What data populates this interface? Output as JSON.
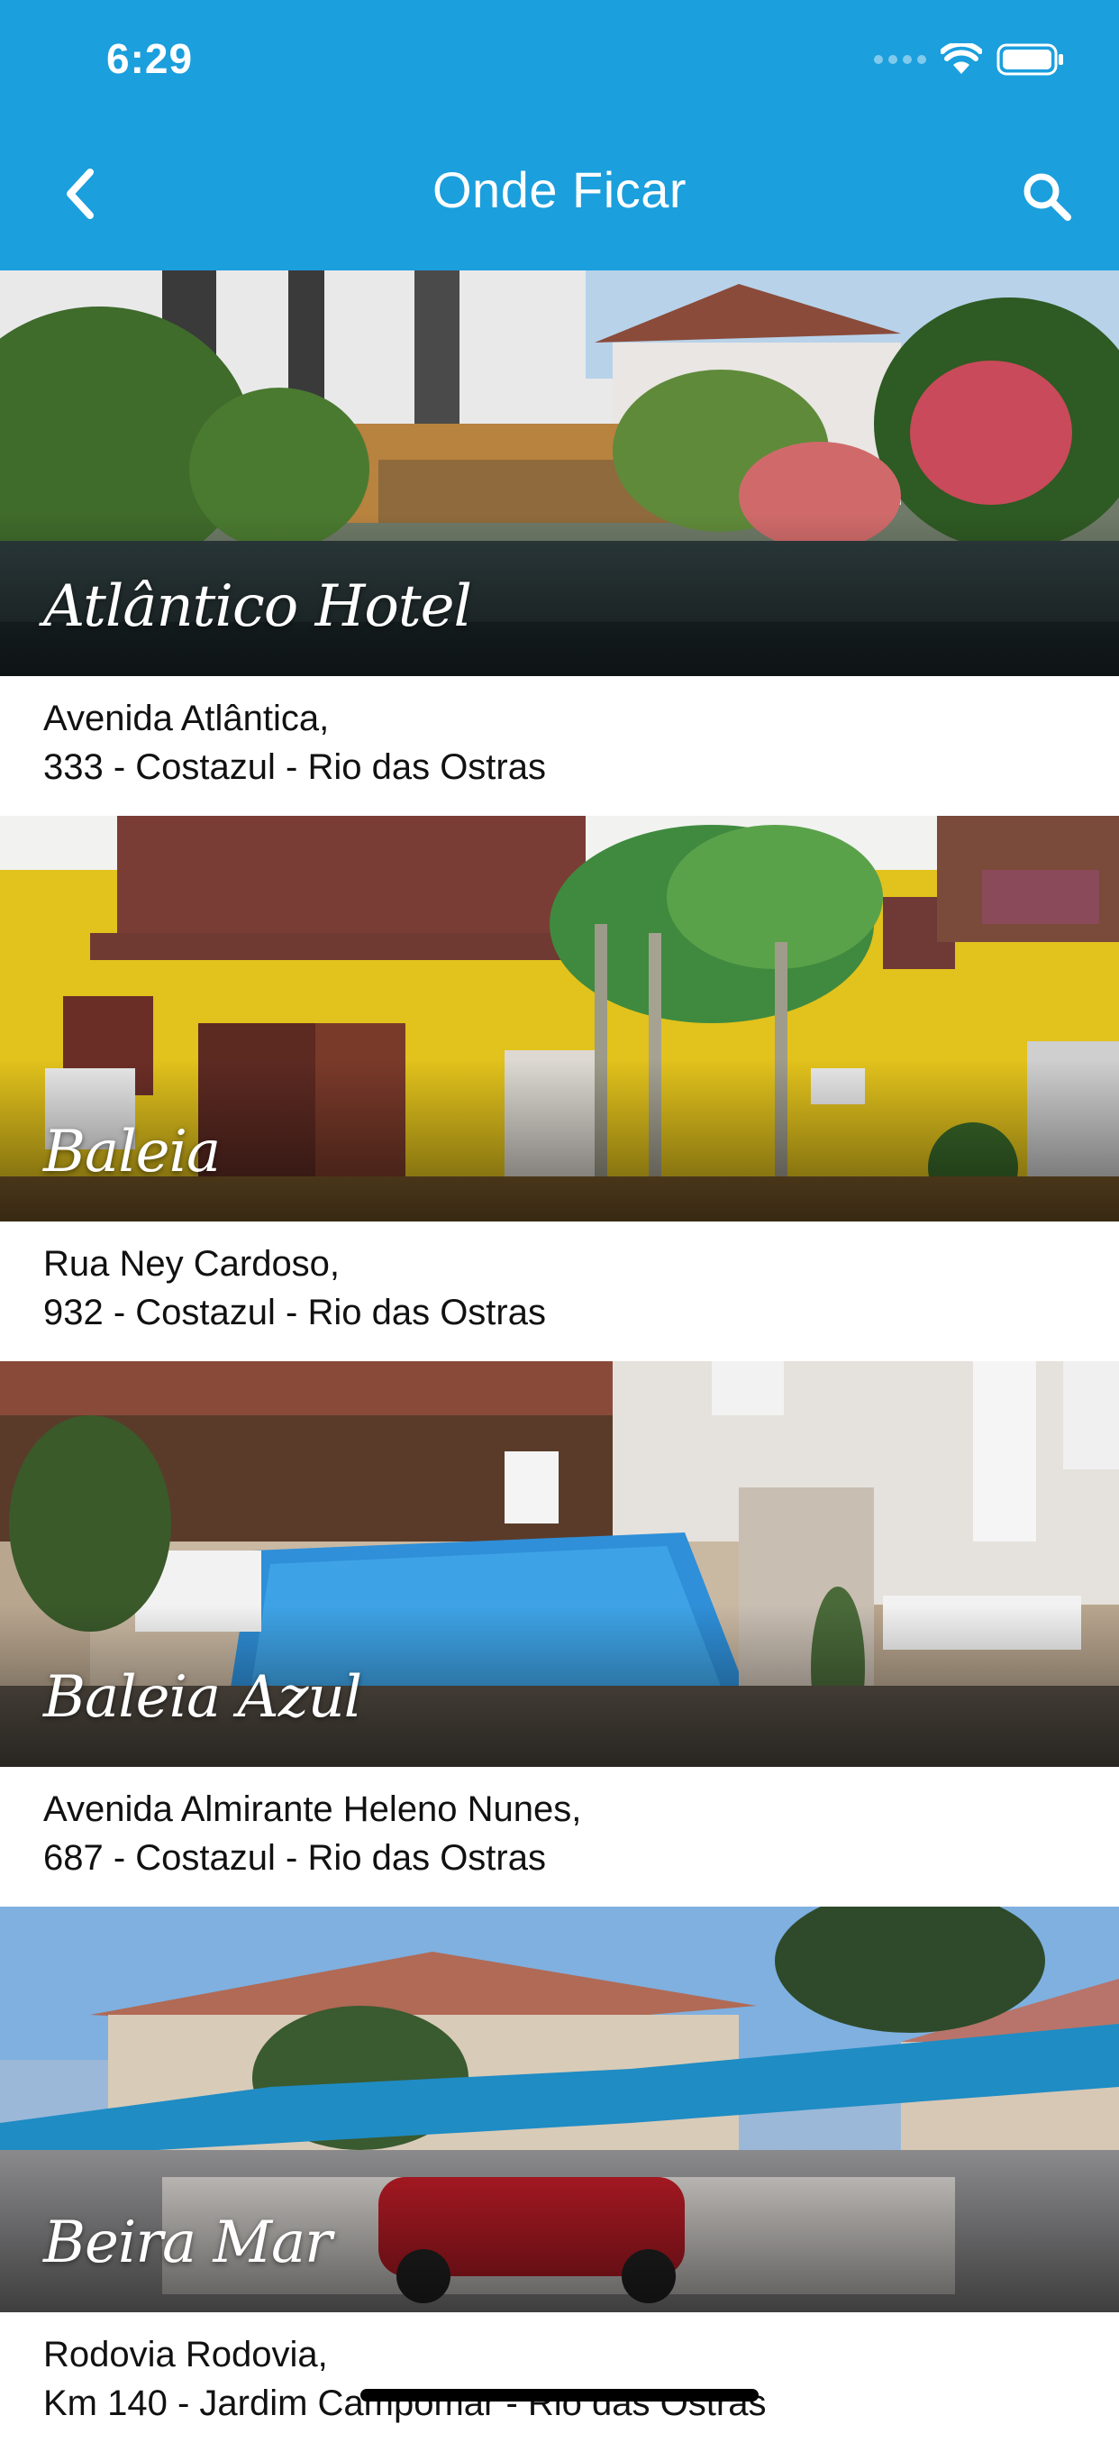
{
  "status_bar": {
    "time": "6:29",
    "icons": [
      "signal-icon",
      "wifi-icon",
      "battery-icon"
    ]
  },
  "header": {
    "title": "Onde Ficar",
    "back_icon": "chevron-left-icon",
    "search_icon": "search-icon",
    "background": "#1b9fdd"
  },
  "hotels": [
    {
      "name": "Atlântico Hotel",
      "address_line1": "Avenida Atlântica,",
      "address_line2": "333 - Costazul - Rio das Ostras"
    },
    {
      "name": "Baleia",
      "address_line1": "Rua Ney Cardoso,",
      "address_line2": "932 - Costazul - Rio das Ostras"
    },
    {
      "name": "Baleia Azul",
      "address_line1": "Avenida Almirante Heleno Nunes,",
      "address_line2": "687 - Costazul - Rio das Ostras"
    },
    {
      "name": "Beira Mar",
      "address_line1": "Rodovia Rodovia,",
      "address_line2": "Km 140 - Jardim Campomar - Rio das Ostras"
    }
  ]
}
